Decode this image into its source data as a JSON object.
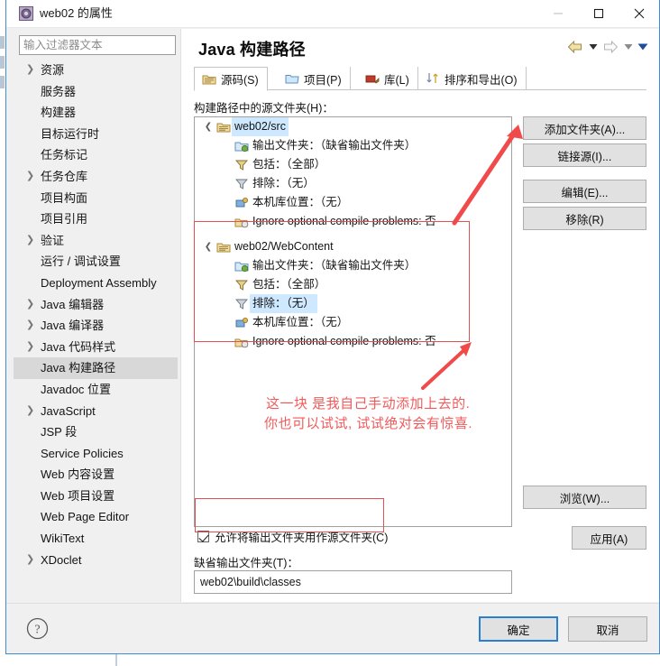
{
  "window": {
    "title": "web02 的属性",
    "icon": "properties-icon",
    "controls": {
      "minimize": "–",
      "maximize": "□",
      "close": "✕"
    }
  },
  "sidebar": {
    "filter": {
      "placeholder": "输入过滤器文本",
      "value": ""
    },
    "items": [
      {
        "label": "资源",
        "expandable": true,
        "selected": false
      },
      {
        "label": "服务器",
        "expandable": false,
        "selected": false
      },
      {
        "label": "构建器",
        "expandable": false,
        "selected": false
      },
      {
        "label": "目标运行时",
        "expandable": false,
        "selected": false
      },
      {
        "label": "任务标记",
        "expandable": false,
        "selected": false
      },
      {
        "label": "任务仓库",
        "expandable": true,
        "selected": false
      },
      {
        "label": "项目构面",
        "expandable": false,
        "selected": false
      },
      {
        "label": "项目引用",
        "expandable": false,
        "selected": false
      },
      {
        "label": "验证",
        "expandable": true,
        "selected": false
      },
      {
        "label": "运行 / 调试设置",
        "expandable": false,
        "selected": false
      },
      {
        "label": "Deployment Assembly",
        "expandable": false,
        "selected": false
      },
      {
        "label": "Java 编辑器",
        "expandable": true,
        "selected": false
      },
      {
        "label": "Java 编译器",
        "expandable": true,
        "selected": false
      },
      {
        "label": "Java 代码样式",
        "expandable": true,
        "selected": false
      },
      {
        "label": "Java 构建路径",
        "expandable": false,
        "selected": true
      },
      {
        "label": "Javadoc 位置",
        "expandable": false,
        "selected": false
      },
      {
        "label": "JavaScript",
        "expandable": true,
        "selected": false
      },
      {
        "label": "JSP 段",
        "expandable": false,
        "selected": false
      },
      {
        "label": "Service Policies",
        "expandable": false,
        "selected": false
      },
      {
        "label": "Web 内容设置",
        "expandable": false,
        "selected": false
      },
      {
        "label": "Web 项目设置",
        "expandable": false,
        "selected": false
      },
      {
        "label": "Web Page Editor",
        "expandable": false,
        "selected": false
      },
      {
        "label": "WikiText",
        "expandable": false,
        "selected": false
      },
      {
        "label": "XDoclet",
        "expandable": true,
        "selected": false
      }
    ]
  },
  "content": {
    "page_title": "Java 构建路径",
    "nav": {
      "back_icon": "back-arrow-icon",
      "back_menu_icon": "chevron-down-icon",
      "forward_icon": "forward-arrow-icon",
      "forward_menu_icon": "chevron-down-icon",
      "more_menu_icon": "chevron-down-icon"
    },
    "tabs": [
      {
        "label": "源码(S)",
        "icon": "source-folder-icon",
        "active": true
      },
      {
        "label": "项目(P)",
        "icon": "project-folder-icon",
        "active": false
      },
      {
        "label": "库(L)",
        "icon": "library-icon",
        "active": false
      },
      {
        "label": "排序和导出(O)",
        "icon": "order-export-icon",
        "active": false
      }
    ],
    "section_label": "构建路径中的源文件夹(H)：",
    "tree": [
      {
        "label": "web02/src",
        "icon": "source-folder-icon",
        "expanded": true,
        "highlighted": true,
        "children": [
          {
            "label": "输出文件夹：（缺省输出文件夹）",
            "icon": "output-folder-icon",
            "highlighted": false
          },
          {
            "label": "包括：（全部）",
            "icon": "include-filter-icon",
            "highlighted": false
          },
          {
            "label": "排除：（无）",
            "icon": "exclude-filter-icon",
            "highlighted": false
          },
          {
            "label": "本机库位置：（无）",
            "icon": "native-library-icon",
            "highlighted": false
          },
          {
            "label": "Ignore optional compile problems: 否",
            "icon": "compile-problems-icon",
            "highlighted": false
          }
        ]
      },
      {
        "label": "web02/WebContent",
        "icon": "source-folder-icon",
        "expanded": true,
        "highlighted": false,
        "children": [
          {
            "label": "输出文件夹：（缺省输出文件夹）",
            "icon": "output-folder-icon",
            "highlighted": false
          },
          {
            "label": "包括：（全部）",
            "icon": "include-filter-icon",
            "highlighted": false
          },
          {
            "label": "排除：（无）",
            "icon": "exclude-filter-icon",
            "highlighted": true
          },
          {
            "label": "本机库位置：（无）",
            "icon": "native-library-icon",
            "highlighted": false
          },
          {
            "label": "Ignore optional compile problems: 否",
            "icon": "compile-problems-icon",
            "highlighted": false
          }
        ]
      }
    ],
    "buttons": {
      "add_folder": "添加文件夹(A)...",
      "link_source": "链接源(I)...",
      "edit": "编辑(E)...",
      "remove": "移除(R)",
      "browse": "浏览(W)...",
      "apply": "应用(A)"
    },
    "checkbox": {
      "label": "允许将输出文件夹用作源文件夹(C)",
      "checked": true
    },
    "default_output": {
      "label": "缺省输出文件夹(T)：",
      "value": "web02\\build\\classes"
    }
  },
  "annotations": {
    "color": "#f05a5a",
    "line1": "这一块 是我自己手动添加上去的.",
    "line2": "你也可以试试, 试试绝对会有惊喜."
  },
  "footer": {
    "help_icon": "help-question-icon",
    "ok": "确定",
    "cancel": "取消"
  }
}
